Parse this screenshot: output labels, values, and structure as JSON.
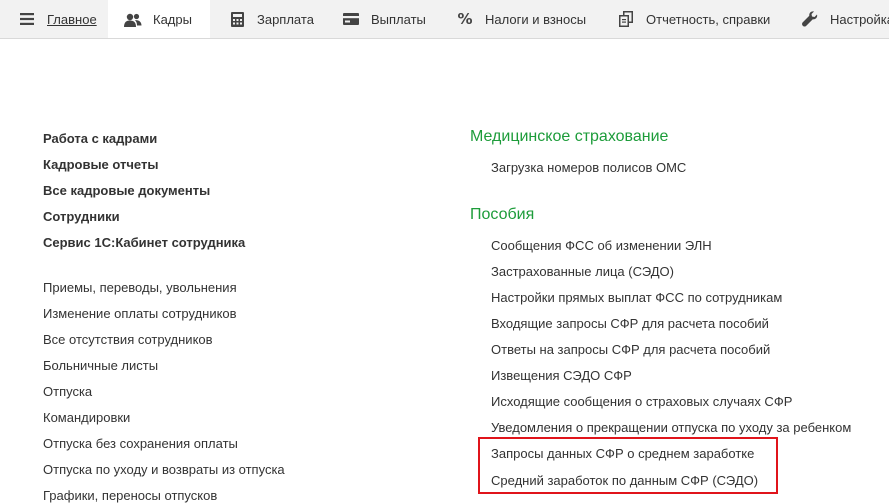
{
  "tabs": [
    {
      "label": "Главное",
      "icon": "menu-icon",
      "active": false
    },
    {
      "label": "Кадры",
      "icon": "people-icon",
      "active": true
    },
    {
      "label": "Зарплата",
      "icon": "calculator-icon",
      "active": false
    },
    {
      "label": "Выплаты",
      "icon": "wallet-icon",
      "active": false
    },
    {
      "label": "Налоги и взносы",
      "icon": "percent-icon",
      "active": false
    },
    {
      "label": "Отчетность, справки",
      "icon": "documents-icon",
      "active": false
    },
    {
      "label": "Настройка",
      "icon": "wrench-icon",
      "active": false
    }
  ],
  "left": {
    "main_links": [
      "Работа с кадрами",
      "Кадровые отчеты",
      "Все кадровые документы",
      "Сотрудники",
      "Сервис 1С:Кабинет сотрудника"
    ],
    "links": [
      "Приемы, переводы, увольнения",
      "Изменение оплаты сотрудников",
      "Все отсутствия сотрудников",
      "Больничные листы",
      "Отпуска",
      "Командировки",
      "Отпуска без сохранения оплаты",
      "Отпуска по уходу и возвраты из отпуска",
      "Графики, переносы отпусков"
    ]
  },
  "right": {
    "medical": {
      "title": "Медицинское страхование",
      "links": [
        "Загрузка номеров полисов ОМС"
      ]
    },
    "benefits": {
      "title": "Пособия",
      "links": [
        "Сообщения ФСС об изменении ЭЛН",
        "Застрахованные лица (СЭДО)",
        "Настройки прямых выплат ФСС по сотрудникам",
        "Входящие запросы СФР для расчета пособий",
        "Ответы на запросы СФР для расчета пособий",
        "Извещения СЭДО СФР",
        "Исходящие сообщения о страховых случаях СФР",
        "Уведомления о прекращении отпуска по уходу за ребенком",
        "Запросы данных СФР о среднем заработке",
        "Средний заработок по данным СФР (СЭДО)"
      ]
    }
  },
  "colors": {
    "section_title": "#1d9c3a",
    "highlight": "#e0141b",
    "tabbar_bg": "#f2f2f2"
  }
}
